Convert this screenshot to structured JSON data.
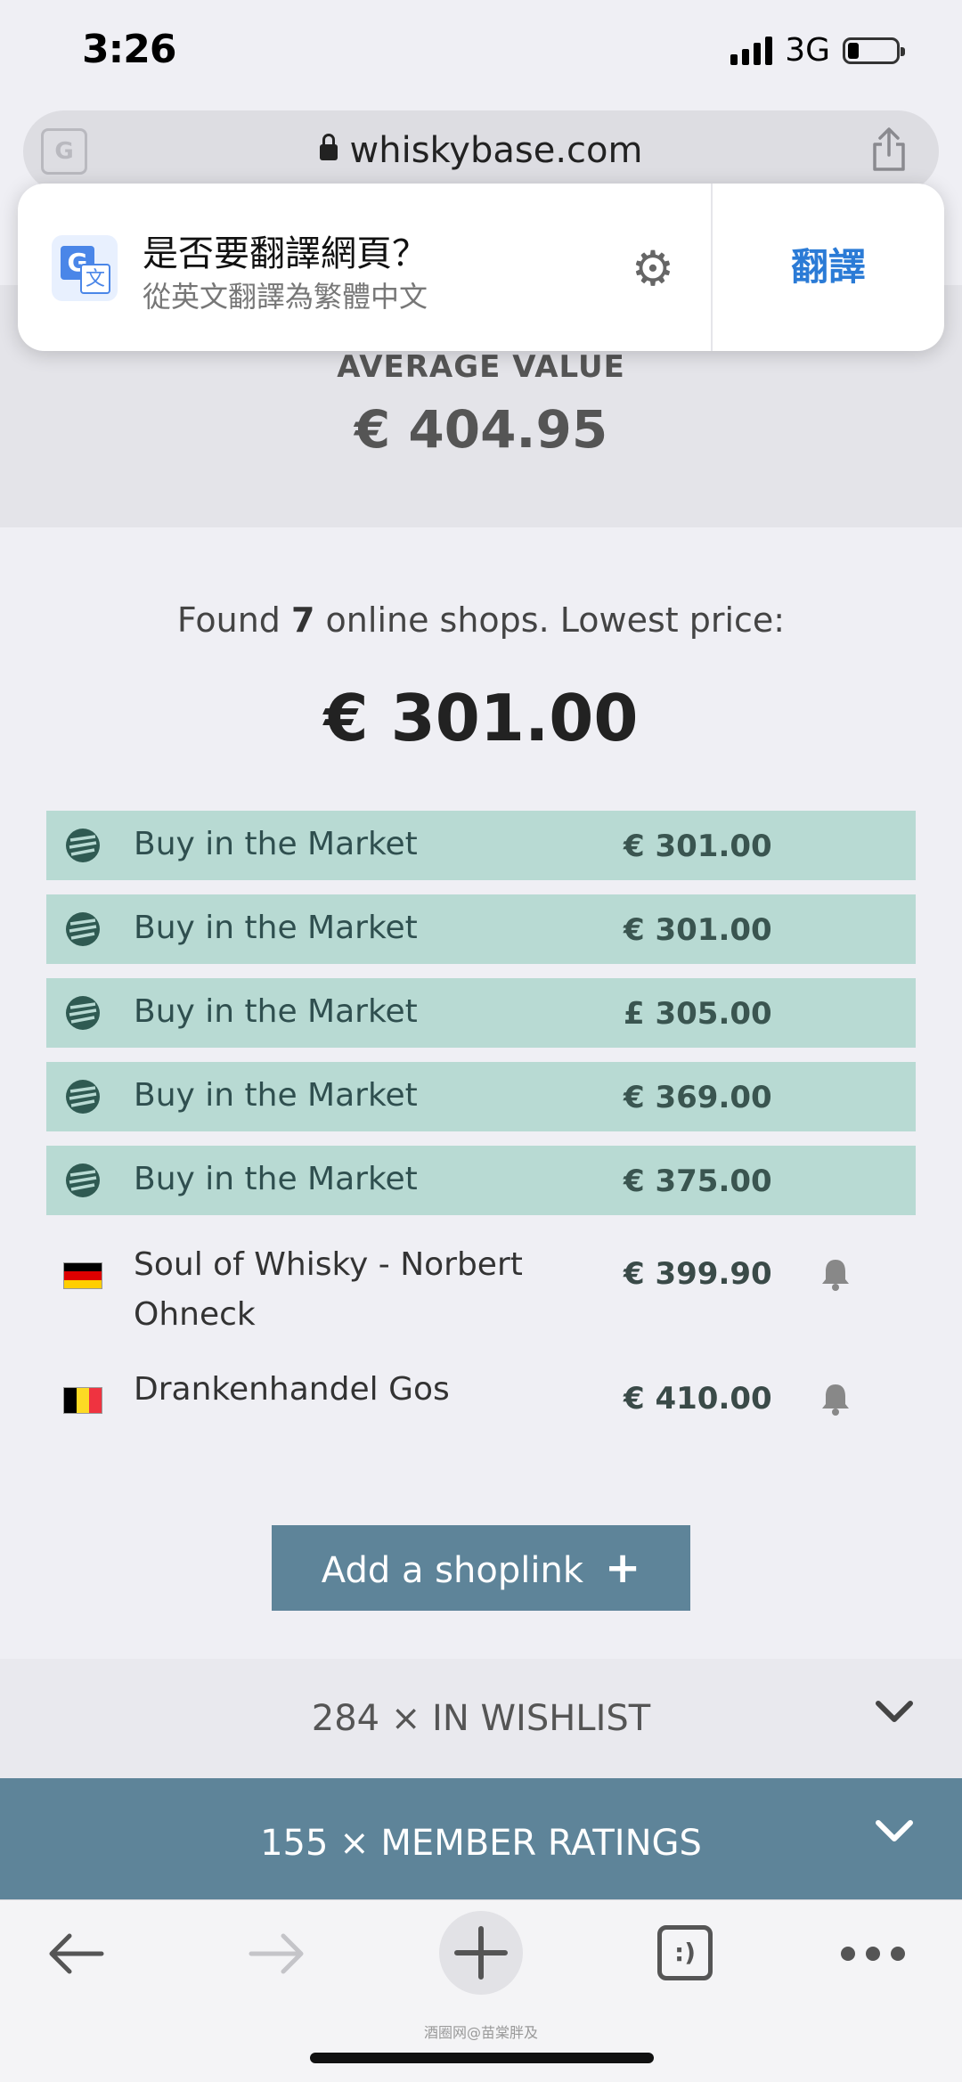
{
  "status_bar": {
    "time": "3:26",
    "network": "3G"
  },
  "browser": {
    "url": "whiskybase.com"
  },
  "translate_popup": {
    "title": "是否要翻譯網頁？",
    "subtitle": "從英文翻譯為繁體中文",
    "translate_label": "翻譯"
  },
  "average": {
    "label": "AVERAGE VALUE",
    "value": "€ 404.95"
  },
  "found": {
    "prefix": "Found ",
    "count": "7",
    "suffix": " online shops. Lowest price:"
  },
  "lowest_price": "€ 301.00",
  "shops": [
    {
      "name": "Buy in the Market",
      "price": "€ 301.00",
      "type": "market"
    },
    {
      "name": "Buy in the Market",
      "price": "€ 301.00",
      "type": "market"
    },
    {
      "name": "Buy in the Market",
      "price": "£ 305.00",
      "type": "market"
    },
    {
      "name": "Buy in the Market",
      "price": "€ 369.00",
      "type": "market"
    },
    {
      "name": "Buy in the Market",
      "price": "€ 375.00",
      "type": "market"
    },
    {
      "name": "Soul of Whisky - Norbert Ohneck",
      "price": "€ 399.90",
      "type": "shop",
      "flag": "germany-flag"
    },
    {
      "name": "Drankenhandel Gos",
      "price": "€ 410.00",
      "type": "shop",
      "flag": "belgium-flag"
    }
  ],
  "add_shoplink_label": "Add a shoplink",
  "wishlist_label": "284 × IN WISHLIST",
  "ratings_label": "155 × MEMBER RATINGS",
  "watermark": "酒圈网@苗棠胖及",
  "colors": {
    "market_row": "#b8dad3",
    "accent": "#5e8499",
    "translate_link": "#2b7bd6"
  },
  "icons": {
    "market": "stacked-layers-icon",
    "bell": "bell-icon",
    "share": "share-icon",
    "gear": "gear-icon",
    "translate": "google-translate-icon"
  }
}
